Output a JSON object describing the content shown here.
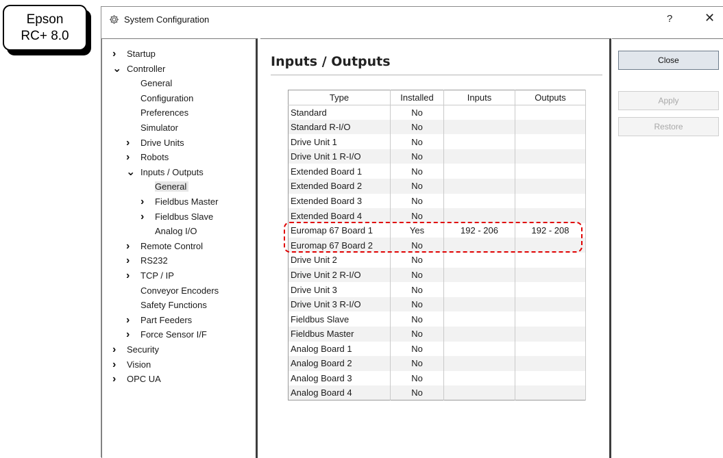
{
  "badge": {
    "line1": "Epson",
    "line2": "RC+ 8.0"
  },
  "window": {
    "title": "System Configuration",
    "help_glyph": "?",
    "close_glyph": "✕",
    "icon": "gear-icon"
  },
  "tree": [
    {
      "label": "Startup",
      "chevron": "›",
      "expanded": false,
      "level": 0
    },
    {
      "label": "Controller",
      "chevron": "⌄",
      "expanded": true,
      "level": 0
    },
    {
      "label": "General",
      "chevron": "",
      "level": 1
    },
    {
      "label": "Configuration",
      "chevron": "",
      "level": 1
    },
    {
      "label": "Preferences",
      "chevron": "",
      "level": 1
    },
    {
      "label": "Simulator",
      "chevron": "",
      "level": 1
    },
    {
      "label": "Drive Units",
      "chevron": "›",
      "level": 1
    },
    {
      "label": "Robots",
      "chevron": "›",
      "level": 1
    },
    {
      "label": "Inputs / Outputs",
      "chevron": "⌄",
      "expanded": true,
      "level": 1
    },
    {
      "label": "General",
      "chevron": "",
      "level": 2,
      "selected": true
    },
    {
      "label": "Fieldbus Master",
      "chevron": "›",
      "level": 2
    },
    {
      "label": "Fieldbus Slave",
      "chevron": "›",
      "level": 2
    },
    {
      "label": "Analog I/O",
      "chevron": "",
      "level": 2
    },
    {
      "label": "Remote Control",
      "chevron": "›",
      "level": 1
    },
    {
      "label": "RS232",
      "chevron": "›",
      "level": 1
    },
    {
      "label": "TCP / IP",
      "chevron": "›",
      "level": 1
    },
    {
      "label": "Conveyor Encoders",
      "chevron": "",
      "level": 1
    },
    {
      "label": "Safety Functions",
      "chevron": "",
      "level": 1
    },
    {
      "label": "Part Feeders",
      "chevron": "›",
      "level": 1
    },
    {
      "label": "Force Sensor I/F",
      "chevron": "›",
      "level": 1
    },
    {
      "label": "Security",
      "chevron": "›",
      "level": 0
    },
    {
      "label": "Vision",
      "chevron": "›",
      "level": 0
    },
    {
      "label": "OPC UA",
      "chevron": "›",
      "level": 0
    }
  ],
  "main": {
    "title": "Inputs / Outputs",
    "columns": [
      "Type",
      "Installed",
      "Inputs",
      "Outputs"
    ],
    "rows": [
      {
        "type": "Standard",
        "installed": "No",
        "inputs": "",
        "outputs": ""
      },
      {
        "type": "Standard R-I/O",
        "installed": "No",
        "inputs": "",
        "outputs": ""
      },
      {
        "type": "Drive Unit 1",
        "installed": "No",
        "inputs": "",
        "outputs": ""
      },
      {
        "type": "Drive Unit 1 R-I/O",
        "installed": "No",
        "inputs": "",
        "outputs": ""
      },
      {
        "type": "Extended Board 1",
        "installed": "No",
        "inputs": "",
        "outputs": ""
      },
      {
        "type": "Extended Board 2",
        "installed": "No",
        "inputs": "",
        "outputs": ""
      },
      {
        "type": "Extended Board 3",
        "installed": "No",
        "inputs": "",
        "outputs": ""
      },
      {
        "type": "Extended Board 4",
        "installed": "No",
        "inputs": "",
        "outputs": ""
      },
      {
        "type": "Euromap 67 Board 1",
        "installed": "Yes",
        "inputs": "192 - 206",
        "outputs": "192 - 208"
      },
      {
        "type": "Euromap 67 Board 2",
        "installed": "No",
        "inputs": "",
        "outputs": ""
      },
      {
        "type": "Drive Unit 2",
        "installed": "No",
        "inputs": "",
        "outputs": ""
      },
      {
        "type": "Drive Unit 2 R-I/O",
        "installed": "No",
        "inputs": "",
        "outputs": ""
      },
      {
        "type": "Drive Unit 3",
        "installed": "No",
        "inputs": "",
        "outputs": ""
      },
      {
        "type": "Drive Unit 3 R-I/O",
        "installed": "No",
        "inputs": "",
        "outputs": ""
      },
      {
        "type": "Fieldbus Slave",
        "installed": "No",
        "inputs": "",
        "outputs": ""
      },
      {
        "type": "Fieldbus Master",
        "installed": "No",
        "inputs": "",
        "outputs": ""
      },
      {
        "type": "Analog Board 1",
        "installed": "No",
        "inputs": "",
        "outputs": ""
      },
      {
        "type": "Analog Board 2",
        "installed": "No",
        "inputs": "",
        "outputs": ""
      },
      {
        "type": "Analog Board 3",
        "installed": "No",
        "inputs": "",
        "outputs": ""
      },
      {
        "type": "Analog Board 4",
        "installed": "No",
        "inputs": "",
        "outputs": ""
      }
    ],
    "highlight_color": "#e00000"
  },
  "buttons": {
    "close": "Close",
    "apply": "Apply",
    "restore": "Restore"
  }
}
